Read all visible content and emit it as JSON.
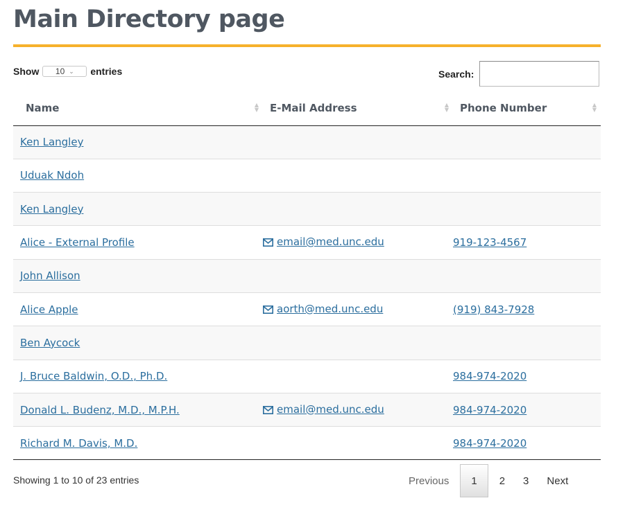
{
  "page": {
    "title": "Main Directory page",
    "accent_color": "#f6b12c",
    "link_color": "#2b6e9e"
  },
  "controls": {
    "show_label": "Show",
    "entries_label": "entries",
    "page_length": "10",
    "search_label": "Search:",
    "search_value": ""
  },
  "table": {
    "columns": [
      {
        "label": "Name"
      },
      {
        "label": "E-Mail Address"
      },
      {
        "label": "Phone Number"
      }
    ],
    "rows": [
      {
        "name": "Ken Langley",
        "email": "",
        "phone": ""
      },
      {
        "name": "Uduak Ndoh",
        "email": "",
        "phone": ""
      },
      {
        "name": "Ken Langley",
        "email": "",
        "phone": ""
      },
      {
        "name": "Alice - External Profile",
        "email": "email@med.unc.edu",
        "phone": "919-123-4567"
      },
      {
        "name": "John Allison",
        "email": "",
        "phone": ""
      },
      {
        "name": "Alice Apple",
        "email": "aorth@med.unc.edu",
        "phone": "(919) 843-7928"
      },
      {
        "name": "Ben Aycock",
        "email": "",
        "phone": ""
      },
      {
        "name": "J. Bruce Baldwin, O.D., Ph.D.",
        "email": "",
        "phone": "984-974-2020"
      },
      {
        "name": "Donald L. Budenz, M.D., M.P.H.",
        "email": "email@med.unc.edu",
        "phone": "984-974-2020"
      },
      {
        "name": "Richard M. Davis, M.D.",
        "email": "",
        "phone": "984-974-2020"
      }
    ]
  },
  "footer": {
    "info": "Showing 1 to 10 of 23 entries",
    "previous": "Previous",
    "pages": [
      "1",
      "2",
      "3"
    ],
    "current_page": "1",
    "next": "Next"
  }
}
